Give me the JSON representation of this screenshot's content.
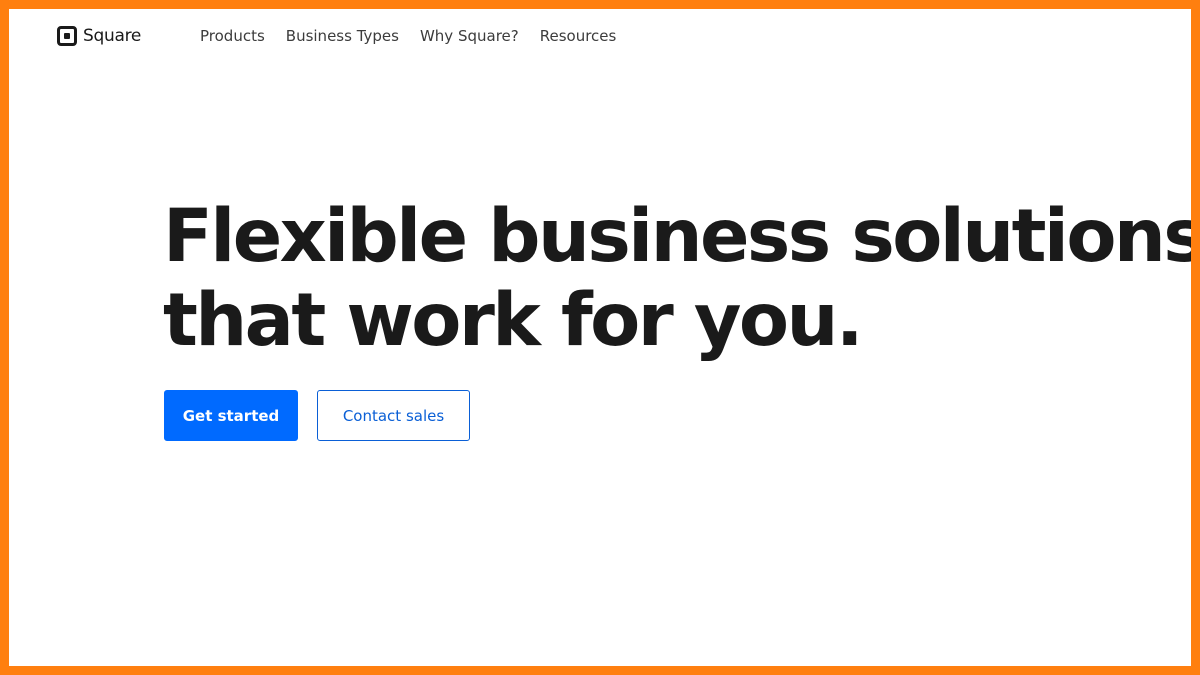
{
  "brand": {
    "name": "Square",
    "logo_icon": "square-logo-icon"
  },
  "nav": {
    "items": [
      {
        "label": "Products"
      },
      {
        "label": "Business Types"
      },
      {
        "label": "Why Square?"
      },
      {
        "label": "Resources"
      }
    ]
  },
  "hero": {
    "headline_line1": "Flexible business solutions",
    "headline_line2": "that work for you."
  },
  "cta": {
    "primary_label": "Get started",
    "secondary_label": "Contact sales"
  },
  "colors": {
    "frame_border": "#ff7f0f",
    "primary": "#006aff",
    "secondary_border": "#0a5fd6",
    "text": "#1a1a1a"
  }
}
